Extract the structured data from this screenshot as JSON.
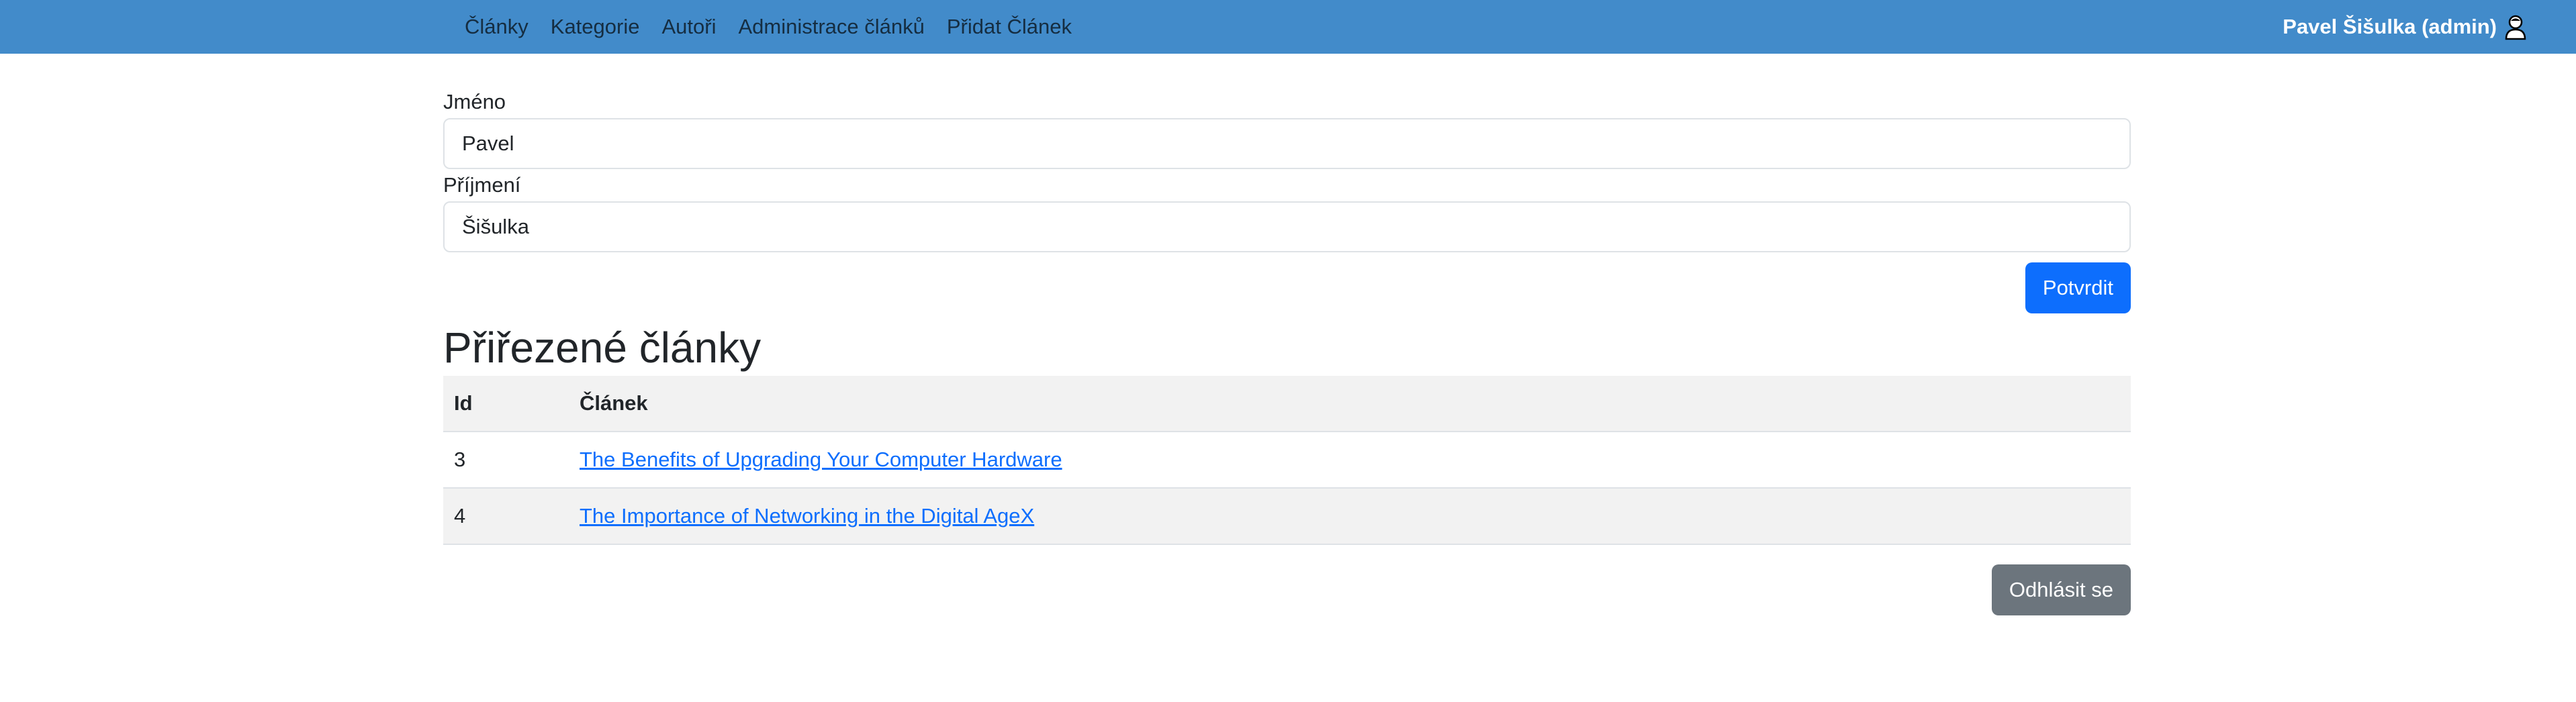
{
  "nav": {
    "links": [
      "Články",
      "Kategorie",
      "Autoři",
      "Administrace článků",
      "Přidat Článek"
    ],
    "user": "Pavel Šišulka (admin)"
  },
  "form": {
    "first_name_label": "Jméno",
    "first_name_value": "Pavel",
    "last_name_label": "Příjmení",
    "last_name_value": "Šišulka",
    "submit_label": "Potvrdit"
  },
  "articles": {
    "title": "Přiřezené články",
    "headers": [
      "Id",
      "Článek"
    ],
    "rows": [
      {
        "id": "3",
        "title": "The Benefits of Upgrading Your Computer Hardware"
      },
      {
        "id": "4",
        "title": "The Importance of Networking in the Digital AgeX"
      }
    ]
  },
  "logout_label": "Odhlásit se",
  "colors": {
    "navbar": "#428bca",
    "primary": "#0d6efd",
    "secondary": "#6c757d",
    "stripe": "#f2f2f2"
  },
  "icons": {
    "user": "user-silhouette-icon"
  }
}
